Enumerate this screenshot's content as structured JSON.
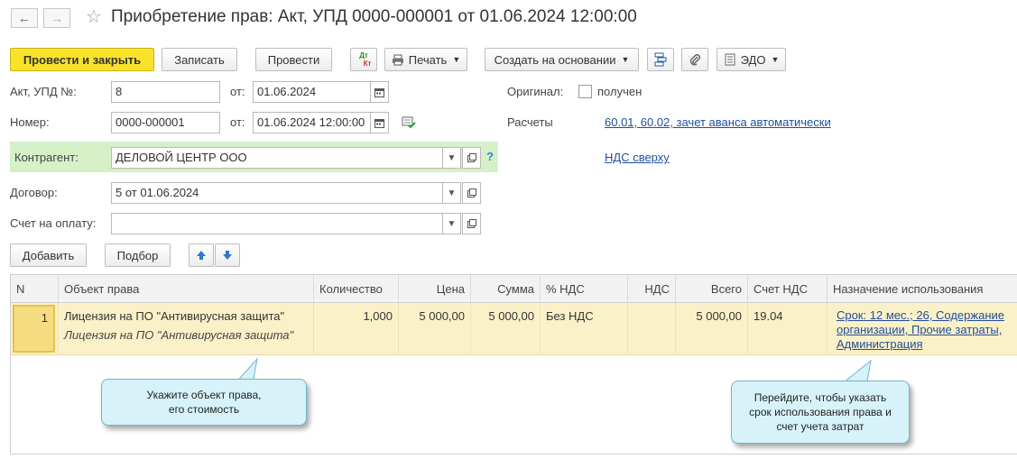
{
  "header": {
    "title": "Приобретение прав: Акт, УПД 0000-000001 от 01.06.2024 12:00:00",
    "back_icon": "←",
    "forward_icon": "→",
    "star_icon": "☆"
  },
  "toolbar": {
    "post_and_close": "Провести и закрыть",
    "save": "Записать",
    "post": "Провести",
    "dt_top": "Дт",
    "dt_bottom": "Кт",
    "print": "Печать",
    "create_based": "Создать на основании",
    "edo": "ЭДО"
  },
  "form": {
    "act_label": "Акт, УПД №:",
    "act_value": "8",
    "from_label": "от:",
    "act_date": "01.06.2024",
    "number_label": "Номер:",
    "number_value": "0000-000001",
    "number_date": "01.06.2024 12:00:00",
    "original_label": "Оригинал:",
    "received_label": "получен",
    "settlements_label": "Расчеты",
    "settlements_link": "60.01, 60.02, зачет аванса автоматически",
    "vat_link": "НДС сверху",
    "counterparty_label": "Контрагент:",
    "counterparty_value": "ДЕЛОВОЙ ЦЕНТР ООО",
    "help": "?",
    "contract_label": "Договор:",
    "contract_value": "5 от 01.06.2024",
    "invoice_label": "Счет на оплату:",
    "invoice_value": ""
  },
  "table_toolbar": {
    "add": "Добавить",
    "select": "Подбор"
  },
  "table": {
    "columns": [
      "N",
      "Объект права",
      "Количество",
      "Цена",
      "Сумма",
      "% НДС",
      "НДС",
      "Всего",
      "Счет НДС",
      "Назначение использования"
    ],
    "rows": [
      {
        "n": "1",
        "object": "Лицензия на ПО \"Антивирусная защита\"",
        "object_sub": "Лицензия на ПО \"Антивирусная защита\"",
        "qty": "1,000",
        "price": "5 000,00",
        "sum": "5 000,00",
        "vat_rate": "Без НДС",
        "vat": "",
        "total": "5 000,00",
        "vat_account": "19.04",
        "purpose_line1": "Срок: 12 мес.; 26, Содержание",
        "purpose_line2": "организации, Прочие затраты,",
        "purpose_line3": "Администрация"
      }
    ]
  },
  "callouts": {
    "left_line1": "Укажите объект права,",
    "left_line2": "его стоимость",
    "right_line1": "Перейдите, чтобы указать",
    "right_line2": "срок использования права и",
    "right_line3": "счет учета затрат"
  },
  "colors": {
    "primary_button": "#f9e22a",
    "link": "#1f4e9c",
    "selected_row": "#fbf1c8",
    "counterparty_band": "#d6f0c8",
    "callout": "#d7f3f9"
  }
}
